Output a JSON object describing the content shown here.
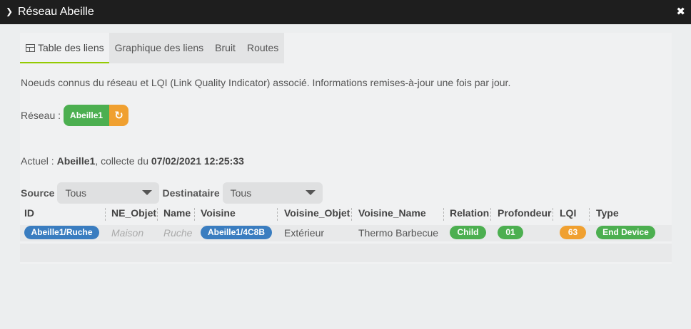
{
  "window": {
    "title": "Réseau Abeille",
    "icons": {
      "chevron": "chevron-right-icon",
      "close": "close-icon"
    }
  },
  "tabs": [
    {
      "label": "Table des liens",
      "active": true,
      "icon": "table-icon"
    },
    {
      "label": "Graphique des liens",
      "active": false
    },
    {
      "label": "Bruit",
      "active": false
    },
    {
      "label": "Routes",
      "active": false
    }
  ],
  "description": "Noeuds connus du réseau et LQI (Link Quality Indicator) associé. Informations remises-à-jour une fois par jour.",
  "network": {
    "label": "Réseau :",
    "button_label": "Abeille1",
    "refresh_icon": "refresh-icon"
  },
  "current": {
    "prefix": "Actuel : ",
    "name": "Abeille1",
    "middle": ", collecte du ",
    "date": "07/02/2021 12:25:33"
  },
  "filters": {
    "source_label": "Source",
    "source_value": "Tous",
    "dest_label": "Destinataire",
    "dest_value": "Tous"
  },
  "table": {
    "headers": [
      "ID",
      "NE_Objet",
      "Name",
      "Voisine",
      "Voisine_Objet",
      "Voisine_Name",
      "Relation",
      "Profondeur",
      "LQI",
      "Type"
    ],
    "rows": [
      {
        "id": "Abeille1/Ruche",
        "ne_objet": "Maison",
        "name": "Ruche",
        "voisine": "Abeille1/4C8B",
        "voisine_objet": "Extérieur",
        "voisine_name": "Thermo Barbecue",
        "relation": "Child",
        "profondeur": "01",
        "lqi": "63",
        "type": "End Device"
      }
    ]
  },
  "colors": {
    "titlebar": "#1e1e1e",
    "accent_green": "#4caf50",
    "accent_blue": "#3a7dc0",
    "accent_orange": "#f0a030",
    "tab_underline": "#94ca02"
  }
}
